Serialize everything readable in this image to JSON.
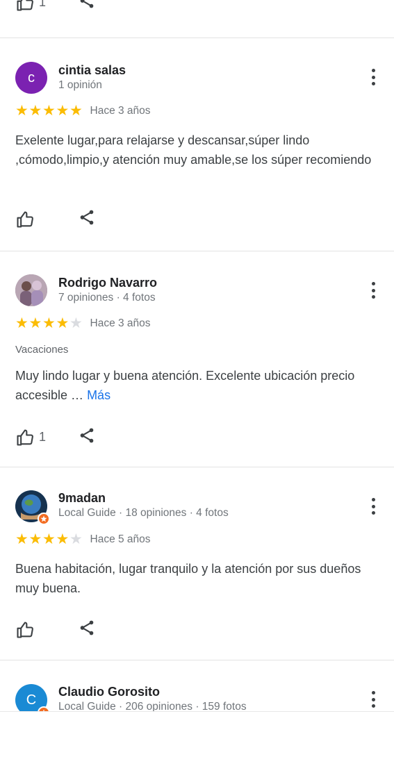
{
  "top_actions": {
    "like_count": "1"
  },
  "reviews": [
    {
      "avatar_letter": "c",
      "avatar_color": "#7b22b1",
      "name": "cintia salas",
      "meta": "1 opinión",
      "rating": 5,
      "date": "Hace 3 años",
      "tag": "",
      "text": "Exelente lugar,para relajarse y descansar,súper lindo ,cómodo,limpio,y atención muy amable,se los súper recomiendo",
      "more_label": "",
      "like_count": ""
    },
    {
      "avatar_letter": "",
      "avatar_color": "#8d7b8a",
      "name": "Rodrigo Navarro",
      "meta": "7 opiniones · 4 fotos",
      "rating": 4,
      "date": "Hace 3 años",
      "tag": "Vacaciones",
      "text": "Muy lindo lugar y buena atención. Excelente ubicación precio accesible …",
      "more_label": "Más",
      "like_count": "1"
    },
    {
      "avatar_letter": "",
      "avatar_color": "#2d5f8c",
      "name": "9madan",
      "meta": "Local Guide · 18 opiniones · 4 fotos",
      "rating": 4,
      "date": "Hace 5 años",
      "tag": "",
      "text": "Buena habitación, lugar tranquilo y la atención por sus dueños muy buena.",
      "more_label": "",
      "like_count": ""
    },
    {
      "avatar_letter": "C",
      "avatar_color": "#1a8ad4",
      "name": "Claudio Gorosito",
      "meta": "Local Guide · 206 opiniones · 159 fotos",
      "rating": 0,
      "date": "",
      "tag": "",
      "text": "",
      "more_label": "",
      "like_count": ""
    }
  ],
  "icons": {
    "like": "thumb-up-outline-icon",
    "share": "share-icon",
    "more": "more-vertical-icon",
    "local_guide": "local-guide-badge-icon",
    "star_color": "#fbbc04"
  }
}
